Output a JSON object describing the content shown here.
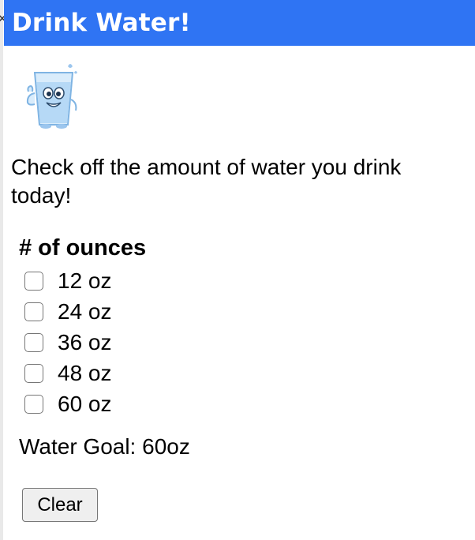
{
  "header": {
    "title": "Drink Water!"
  },
  "mascot": {
    "icon": "water-glass-mascot-icon"
  },
  "intro": {
    "text": "Check off the amount of water you drink today!"
  },
  "ounces": {
    "title": "# of ounces",
    "options": [
      {
        "label": "12 oz",
        "checked": false
      },
      {
        "label": "24 oz",
        "checked": false
      },
      {
        "label": "36 oz",
        "checked": false
      },
      {
        "label": "48 oz",
        "checked": false
      },
      {
        "label": "60 oz",
        "checked": false
      }
    ]
  },
  "goal": {
    "text": "Water Goal: 60oz"
  },
  "actions": {
    "clear_label": "Clear"
  },
  "colors": {
    "header_bg": "#2f74f3",
    "header_text": "#ffffff"
  }
}
